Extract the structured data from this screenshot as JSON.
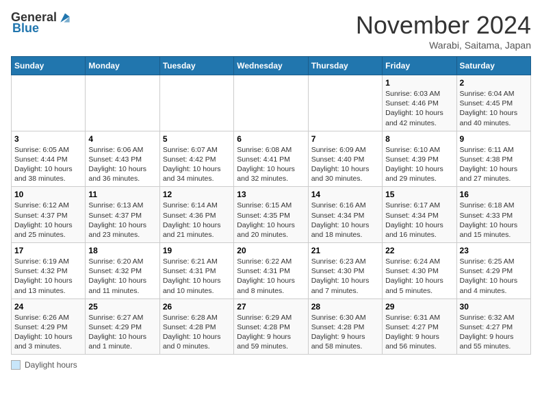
{
  "header": {
    "logo_general": "General",
    "logo_blue": "Blue",
    "month": "November 2024",
    "location": "Warabi, Saitama, Japan"
  },
  "days_of_week": [
    "Sunday",
    "Monday",
    "Tuesday",
    "Wednesday",
    "Thursday",
    "Friday",
    "Saturday"
  ],
  "legend_label": "Daylight hours",
  "weeks": [
    [
      {
        "day": "",
        "info": ""
      },
      {
        "day": "",
        "info": ""
      },
      {
        "day": "",
        "info": ""
      },
      {
        "day": "",
        "info": ""
      },
      {
        "day": "",
        "info": ""
      },
      {
        "day": "1",
        "info": "Sunrise: 6:03 AM\nSunset: 4:46 PM\nDaylight: 10 hours\nand 42 minutes."
      },
      {
        "day": "2",
        "info": "Sunrise: 6:04 AM\nSunset: 4:45 PM\nDaylight: 10 hours\nand 40 minutes."
      }
    ],
    [
      {
        "day": "3",
        "info": "Sunrise: 6:05 AM\nSunset: 4:44 PM\nDaylight: 10 hours\nand 38 minutes."
      },
      {
        "day": "4",
        "info": "Sunrise: 6:06 AM\nSunset: 4:43 PM\nDaylight: 10 hours\nand 36 minutes."
      },
      {
        "day": "5",
        "info": "Sunrise: 6:07 AM\nSunset: 4:42 PM\nDaylight: 10 hours\nand 34 minutes."
      },
      {
        "day": "6",
        "info": "Sunrise: 6:08 AM\nSunset: 4:41 PM\nDaylight: 10 hours\nand 32 minutes."
      },
      {
        "day": "7",
        "info": "Sunrise: 6:09 AM\nSunset: 4:40 PM\nDaylight: 10 hours\nand 30 minutes."
      },
      {
        "day": "8",
        "info": "Sunrise: 6:10 AM\nSunset: 4:39 PM\nDaylight: 10 hours\nand 29 minutes."
      },
      {
        "day": "9",
        "info": "Sunrise: 6:11 AM\nSunset: 4:38 PM\nDaylight: 10 hours\nand 27 minutes."
      }
    ],
    [
      {
        "day": "10",
        "info": "Sunrise: 6:12 AM\nSunset: 4:37 PM\nDaylight: 10 hours\nand 25 minutes."
      },
      {
        "day": "11",
        "info": "Sunrise: 6:13 AM\nSunset: 4:37 PM\nDaylight: 10 hours\nand 23 minutes."
      },
      {
        "day": "12",
        "info": "Sunrise: 6:14 AM\nSunset: 4:36 PM\nDaylight: 10 hours\nand 21 minutes."
      },
      {
        "day": "13",
        "info": "Sunrise: 6:15 AM\nSunset: 4:35 PM\nDaylight: 10 hours\nand 20 minutes."
      },
      {
        "day": "14",
        "info": "Sunrise: 6:16 AM\nSunset: 4:34 PM\nDaylight: 10 hours\nand 18 minutes."
      },
      {
        "day": "15",
        "info": "Sunrise: 6:17 AM\nSunset: 4:34 PM\nDaylight: 10 hours\nand 16 minutes."
      },
      {
        "day": "16",
        "info": "Sunrise: 6:18 AM\nSunset: 4:33 PM\nDaylight: 10 hours\nand 15 minutes."
      }
    ],
    [
      {
        "day": "17",
        "info": "Sunrise: 6:19 AM\nSunset: 4:32 PM\nDaylight: 10 hours\nand 13 minutes."
      },
      {
        "day": "18",
        "info": "Sunrise: 6:20 AM\nSunset: 4:32 PM\nDaylight: 10 hours\nand 11 minutes."
      },
      {
        "day": "19",
        "info": "Sunrise: 6:21 AM\nSunset: 4:31 PM\nDaylight: 10 hours\nand 10 minutes."
      },
      {
        "day": "20",
        "info": "Sunrise: 6:22 AM\nSunset: 4:31 PM\nDaylight: 10 hours\nand 8 minutes."
      },
      {
        "day": "21",
        "info": "Sunrise: 6:23 AM\nSunset: 4:30 PM\nDaylight: 10 hours\nand 7 minutes."
      },
      {
        "day": "22",
        "info": "Sunrise: 6:24 AM\nSunset: 4:30 PM\nDaylight: 10 hours\nand 5 minutes."
      },
      {
        "day": "23",
        "info": "Sunrise: 6:25 AM\nSunset: 4:29 PM\nDaylight: 10 hours\nand 4 minutes."
      }
    ],
    [
      {
        "day": "24",
        "info": "Sunrise: 6:26 AM\nSunset: 4:29 PM\nDaylight: 10 hours\nand 3 minutes."
      },
      {
        "day": "25",
        "info": "Sunrise: 6:27 AM\nSunset: 4:29 PM\nDaylight: 10 hours\nand 1 minute."
      },
      {
        "day": "26",
        "info": "Sunrise: 6:28 AM\nSunset: 4:28 PM\nDaylight: 10 hours\nand 0 minutes."
      },
      {
        "day": "27",
        "info": "Sunrise: 6:29 AM\nSunset: 4:28 PM\nDaylight: 9 hours\nand 59 minutes."
      },
      {
        "day": "28",
        "info": "Sunrise: 6:30 AM\nSunset: 4:28 PM\nDaylight: 9 hours\nand 58 minutes."
      },
      {
        "day": "29",
        "info": "Sunrise: 6:31 AM\nSunset: 4:27 PM\nDaylight: 9 hours\nand 56 minutes."
      },
      {
        "day": "30",
        "info": "Sunrise: 6:32 AM\nSunset: 4:27 PM\nDaylight: 9 hours\nand 55 minutes."
      }
    ]
  ]
}
